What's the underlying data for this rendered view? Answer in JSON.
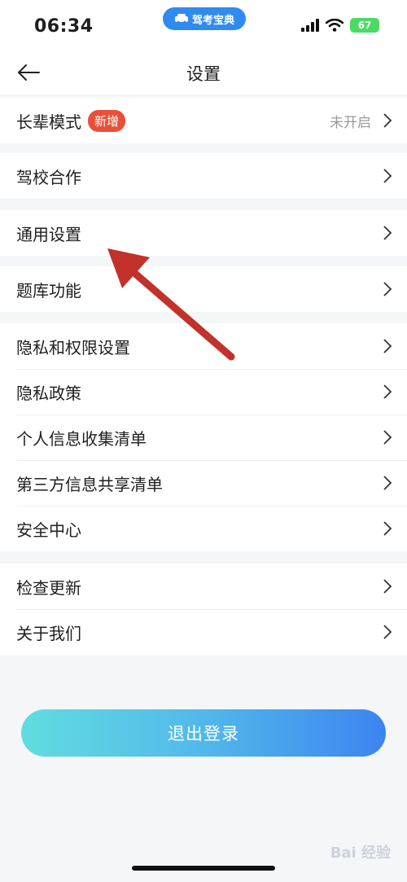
{
  "status_bar": {
    "time": "06:34",
    "app_name": "驾考宝典",
    "battery": "67"
  },
  "nav": {
    "title": "设置"
  },
  "groups": [
    [
      {
        "label": "长辈模式",
        "badge": "新增",
        "value": "未开启"
      }
    ],
    [
      {
        "label": "驾校合作"
      }
    ],
    [
      {
        "label": "通用设置"
      }
    ],
    [
      {
        "label": "题库功能"
      }
    ],
    [
      {
        "label": "隐私和权限设置"
      },
      {
        "label": "隐私政策"
      },
      {
        "label": "个人信息收集清单"
      },
      {
        "label": "第三方信息共享清单"
      },
      {
        "label": "安全中心"
      }
    ],
    [
      {
        "label": "检查更新"
      },
      {
        "label": "关于我们"
      }
    ]
  ],
  "logout_label": "退出登录",
  "watermark": "Bai 经验",
  "colors": {
    "accent": "#2f8bf0",
    "badge": "#e8503a",
    "annotation_arrow": "#c0322b"
  }
}
